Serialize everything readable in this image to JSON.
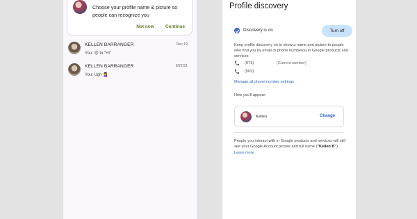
{
  "left_panel": {
    "prompt": {
      "text": "Choose your profile name & picture so people can recognize you",
      "not_now": "Not now",
      "continue": "Continue"
    },
    "conversations": [
      {
        "name": "KELLEN BARRANGER",
        "date": "Dec 19",
        "message": "You: 😍 to \"Hi\""
      },
      {
        "name": "KELLEN BARRANGER",
        "date": "9/22/21",
        "message": "You: Ugh 🤦‍♀️"
      }
    ]
  },
  "right_panel": {
    "title": "Profile discovery",
    "status": "Discovery is on",
    "turn_off": "Turn off",
    "description": "Keep profile discovery on to show a name and picture to people who find you by email or phone number(s) in Google products and services",
    "phones": [
      {
        "number": "(971)",
        "note": "(Current number)"
      },
      {
        "number": "(503)",
        "note": ""
      }
    ],
    "manage_link": "Manage all phone number settings",
    "appear_label": "How you'll appear:",
    "appear_name": "Kellen",
    "change": "Change",
    "footer_text": "People you interact with in Google products and services will still see your Google Account picture and full name (",
    "footer_name": "\"Kellen B\"",
    "footer_end": ").",
    "learn_more": "Learn more"
  },
  "colors": {
    "background": "#e3e3e3",
    "accent_blue": "#2a63b8",
    "action_green": "#5a7a2e",
    "turn_off_bg": "#c9e3fb"
  }
}
